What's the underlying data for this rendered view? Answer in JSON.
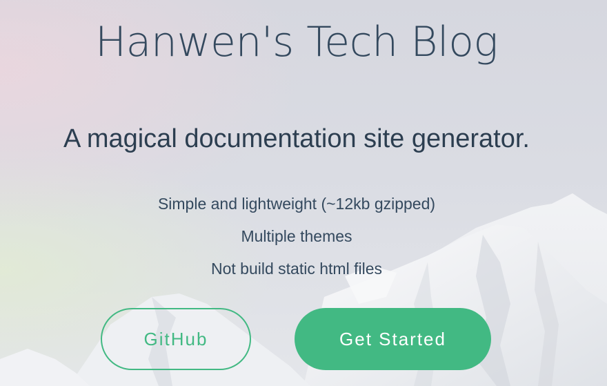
{
  "cover": {
    "title": "Hanwen's Tech Blog",
    "tagline": "A magical documentation site generator.",
    "features": [
      "Simple and lightweight (~12kb gzipped)",
      "Multiple themes",
      "Not build static html files"
    ],
    "buttons": {
      "github": "GitHub",
      "get_started": "Get Started"
    }
  },
  "colors": {
    "accent": "#42b983",
    "text": "#34495e"
  }
}
